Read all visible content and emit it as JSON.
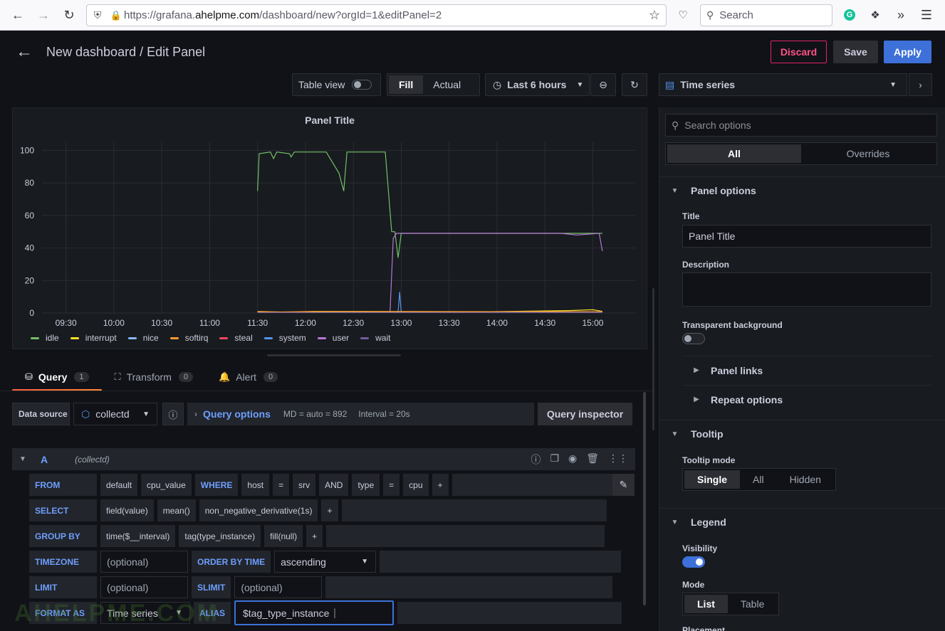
{
  "browser": {
    "url_prefix": "https://grafana.",
    "url_domain": "ahelpme.com",
    "url_suffix": "/dashboard/new?orgId=1&editPanel=2",
    "search_placeholder": "Search"
  },
  "header": {
    "title": "New dashboard / Edit Panel",
    "discard_label": "Discard",
    "save_label": "Save",
    "apply_label": "Apply"
  },
  "toolbar": {
    "table_view_label": "Table view",
    "fill_label": "Fill",
    "actual_label": "Actual",
    "time_range": "Last 6 hours"
  },
  "viz": {
    "type_label": "Time series"
  },
  "panel": {
    "title": "Panel Title"
  },
  "chart_data": {
    "type": "line",
    "title": "Panel Title",
    "x": [
      "09:30",
      "10:00",
      "10:30",
      "11:00",
      "11:30",
      "12:00",
      "12:30",
      "13:00",
      "13:30",
      "14:00",
      "14:30",
      "15:00"
    ],
    "yticks": [
      0,
      20,
      40,
      60,
      80,
      100
    ],
    "ylim": [
      0,
      105
    ],
    "series": [
      {
        "name": "idle",
        "color": "#73bf69"
      },
      {
        "name": "interrupt",
        "color": "#fade2a"
      },
      {
        "name": "nice",
        "color": "#8ab8ff"
      },
      {
        "name": "softirq",
        "color": "#ff9830"
      },
      {
        "name": "steal",
        "color": "#f2495c"
      },
      {
        "name": "system",
        "color": "#5794f2"
      },
      {
        "name": "user",
        "color": "#b877d9"
      },
      {
        "name": "wait",
        "color": "#705da0"
      }
    ],
    "legend_placement": "bottom",
    "grid": true
  },
  "tabs": [
    {
      "label": "Query",
      "count": "1"
    },
    {
      "label": "Transform",
      "count": "0"
    },
    {
      "label": "Alert",
      "count": "0"
    }
  ],
  "query": {
    "datasource_label": "Data source",
    "datasource": "collectd",
    "options_label": "Query options",
    "md": "MD = auto = 892",
    "interval": "Interval = 20s",
    "inspector_label": "Query inspector",
    "ref_id": "A",
    "ref_ds": "(collectd)",
    "from_kw": "FROM",
    "from": [
      "default",
      "cpu_value"
    ],
    "where_kw": "WHERE",
    "where": [
      "host",
      "=",
      "srv",
      "AND",
      "type",
      "=",
      "cpu",
      "+"
    ],
    "select_kw": "SELECT",
    "select": [
      "field(value)",
      "mean()",
      "non_negative_derivative(1s)",
      "+"
    ],
    "groupby_kw": "GROUP BY",
    "groupby": [
      "time($__interval)",
      "tag(type_instance)",
      "fill(null)",
      "+"
    ],
    "timezone_kw": "TIMEZONE",
    "optional": "(optional)",
    "orderby_kw": "ORDER BY TIME",
    "orderby_value": "ascending",
    "limit_kw": "LIMIT",
    "slimit_kw": "SLIMIT",
    "formatas_kw": "FORMAT AS",
    "formatas_value": "Time series",
    "alias_kw": "ALIAS",
    "alias_value": "$tag_type_instance"
  },
  "watermark": "AHELPME.COM",
  "options": {
    "search_placeholder": "Search options",
    "all_label": "All",
    "overrides_label": "Overrides",
    "panel_options": "Panel options",
    "title_label": "Title",
    "title_value": "Panel Title",
    "description_label": "Description",
    "transparent_label": "Transparent background",
    "panel_links": "Panel links",
    "repeat_options": "Repeat options",
    "tooltip": "Tooltip",
    "tooltip_mode_label": "Tooltip mode",
    "tooltip_modes": [
      "Single",
      "All",
      "Hidden"
    ],
    "legend": "Legend",
    "visibility_label": "Visibility",
    "mode_label": "Mode",
    "legend_modes": [
      "List",
      "Table"
    ],
    "placement_label": "Placement"
  }
}
